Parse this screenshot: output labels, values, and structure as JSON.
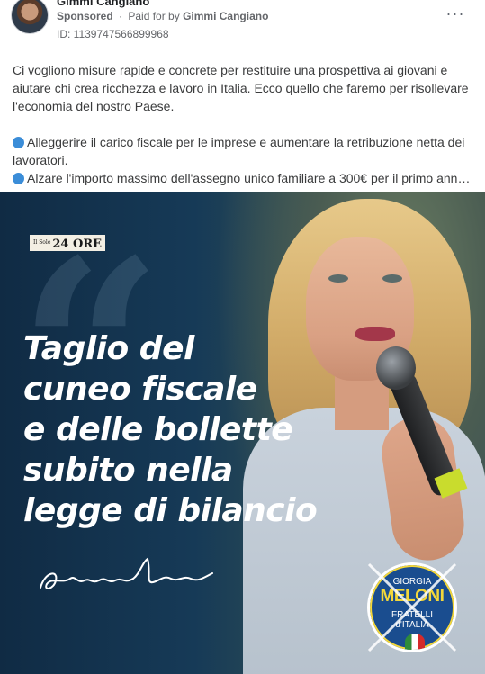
{
  "header": {
    "author": "Gimmi Cangiano",
    "sponsored": "Sponsored",
    "separator": "·",
    "paid_for_prefix": "Paid for by",
    "payer": "Gimmi Cangiano",
    "ad_id": "ID: 1139747566899968",
    "more_glyph": "···"
  },
  "body": {
    "paragraph1": "Ci vogliono misure rapide e concrete per restituire una prospettiva ai giovani e aiutare chi crea ricchezza e lavoro in Italia. Ecco quello che faremo per risollevare l'economia del nostro Paese.",
    "bullet1": "Alleggerire il carico fiscale per le imprese e aumentare la retribuzione netta dei lavoratori.",
    "bullet2": "Alzare l'importo massimo dell'assegno unico familiare a 300€ per il primo ann…"
  },
  "creative": {
    "logo_small": "Il Sole",
    "logo_main": "24 ORE",
    "quote_glyph": "“",
    "headline": [
      "Taglio del",
      "cuneo fiscale",
      "e delle bollette",
      "subito nella",
      "legge di bilancio"
    ],
    "party_logo": {
      "line1": "GIORGIA",
      "line2": "MELONI",
      "line3": "FRATELLI",
      "line4": "d'ITALIA"
    }
  },
  "colors": {
    "bullet": "#3b8dd8",
    "creative_bg": "#102b44",
    "party_blue": "#1a4d8f",
    "party_yellow": "#f3d73a"
  },
  "icons": {
    "bullet": "blue-circle-icon",
    "more": "more-options-icon"
  }
}
